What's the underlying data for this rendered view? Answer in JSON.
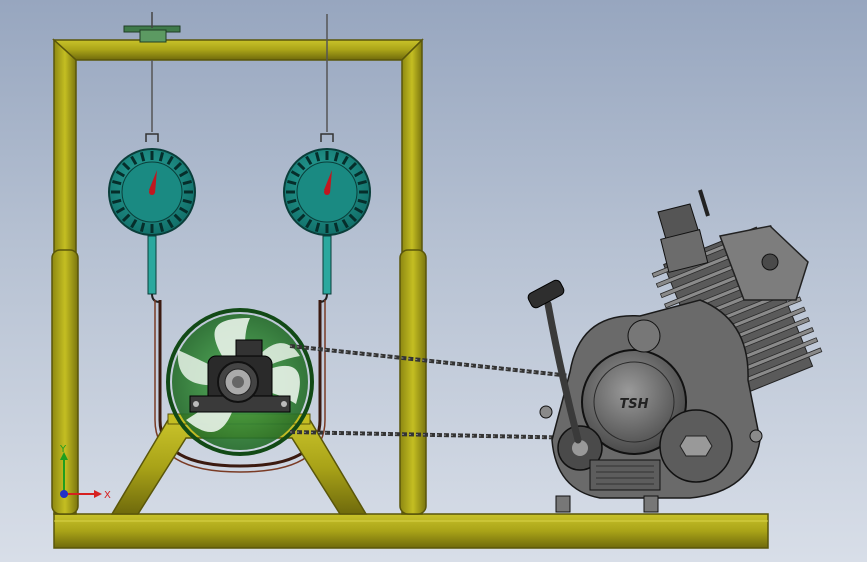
{
  "triad": {
    "x_label": "X",
    "y_label": "Y",
    "x_color": "#d62020",
    "y_color": "#1e9e1e",
    "z_color": "#2030c8"
  },
  "engine": {
    "brand_text": "TSH"
  },
  "colors": {
    "frame": "#b8b21a",
    "frame_dark": "#6f6a0c",
    "gauge_face": "#1a8a82",
    "fan": "#2e7d32",
    "engine": "#6e6e6e"
  },
  "gauges": [
    {
      "name": "left-spring-scale",
      "ticks": 24
    },
    {
      "name": "right-spring-scale",
      "ticks": 24
    }
  ]
}
